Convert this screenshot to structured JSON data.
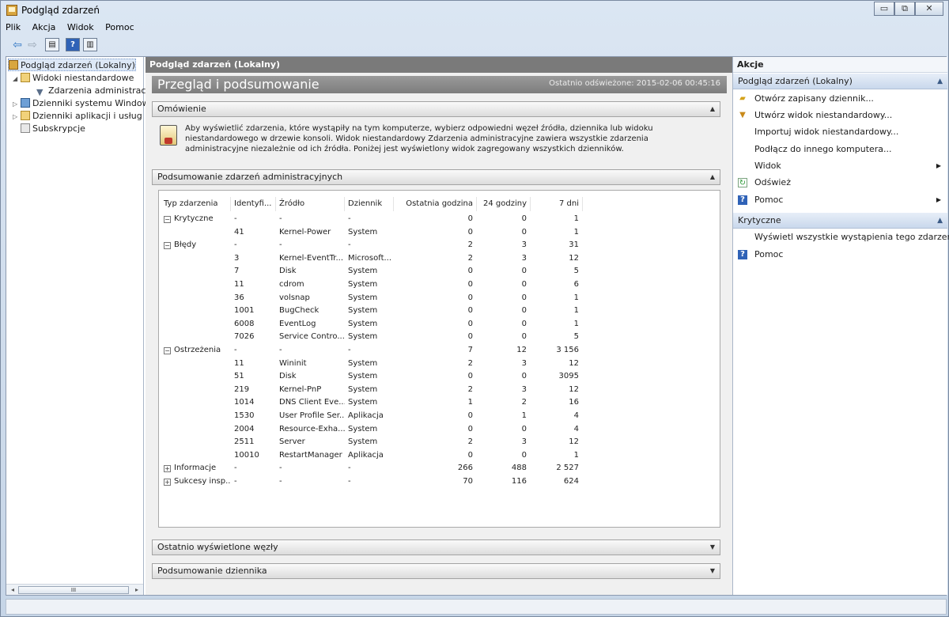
{
  "window": {
    "title": "Podgląd zdarzeń",
    "min_glyph": "▭",
    "max_glyph": "⧉",
    "close_glyph": "✕"
  },
  "menu": [
    "Plik",
    "Akcja",
    "Widok",
    "Pomoc"
  ],
  "toolbar": {
    "back_glyph": "⇦",
    "forward_glyph": "⇨",
    "help_glyph": "?"
  },
  "tree": {
    "root": "Podgląd zdarzeń (Lokalny)",
    "custom_views": "Widoki niestandardowe",
    "admin_events": "Zdarzenia administracyjne",
    "windows_logs": "Dzienniki systemu Windows",
    "app_logs": "Dzienniki aplikacji i usług",
    "subscriptions": "Subskrypcje",
    "scroll_glyph": "III"
  },
  "center": {
    "header": "Podgląd zdarzeń (Lokalny)",
    "banner_title": "Przegląd i podsumowanie",
    "refresh_text": "Ostatnio odświeżone: 2015-02-06 00:45:16",
    "overview_title": "Omówienie",
    "overview_text": "Aby wyświetlić zdarzenia, które wystąpiły na tym komputerze, wybierz odpowiedni węzeł źródła, dziennika lub widoku niestandardowego w drzewie konsoli. Widok niestandardowy Zdarzenia administracyjne zawiera wszystkie zdarzenia administracyjne niezależnie od ich źródła. Poniżej jest wyświetlony widok zagregowany wszystkich dzienników.",
    "summary_title": "Podsumowanie zdarzeń administracyjnych",
    "recent_nodes": "Ostatnio wyświetlone węzły",
    "log_summary": "Podsumowanie dziennika",
    "columns": [
      "Typ zdarzenia",
      "Identyfi...",
      "Źródło",
      "Dziennik",
      "Ostatnia godzina",
      "24 godziny",
      "7 dni"
    ],
    "rows": [
      {
        "type": "Krytyczne",
        "pm": "−",
        "id": "-",
        "source": "-",
        "log": "-",
        "h1": "0",
        "h24": "0",
        "d7": "1"
      },
      {
        "type": "",
        "pm": "",
        "id": "41",
        "source": "Kernel-Power",
        "log": "System",
        "h1": "0",
        "h24": "0",
        "d7": "1"
      },
      {
        "type": "Błędy",
        "pm": "−",
        "id": "-",
        "source": "-",
        "log": "-",
        "h1": "2",
        "h24": "3",
        "d7": "31"
      },
      {
        "type": "",
        "pm": "",
        "id": "3",
        "source": "Kernel-EventTr...",
        "log": "Microsoft...",
        "h1": "2",
        "h24": "3",
        "d7": "12"
      },
      {
        "type": "",
        "pm": "",
        "id": "7",
        "source": "Disk",
        "log": "System",
        "h1": "0",
        "h24": "0",
        "d7": "5"
      },
      {
        "type": "",
        "pm": "",
        "id": "11",
        "source": "cdrom",
        "log": "System",
        "h1": "0",
        "h24": "0",
        "d7": "6"
      },
      {
        "type": "",
        "pm": "",
        "id": "36",
        "source": "volsnap",
        "log": "System",
        "h1": "0",
        "h24": "0",
        "d7": "1"
      },
      {
        "type": "",
        "pm": "",
        "id": "1001",
        "source": "BugCheck",
        "log": "System",
        "h1": "0",
        "h24": "0",
        "d7": "1"
      },
      {
        "type": "",
        "pm": "",
        "id": "6008",
        "source": "EventLog",
        "log": "System",
        "h1": "0",
        "h24": "0",
        "d7": "1"
      },
      {
        "type": "",
        "pm": "",
        "id": "7026",
        "source": "Service Contro...",
        "log": "System",
        "h1": "0",
        "h24": "0",
        "d7": "5"
      },
      {
        "type": "Ostrzeżenia",
        "pm": "−",
        "id": "-",
        "source": "-",
        "log": "-",
        "h1": "7",
        "h24": "12",
        "d7": "3 156"
      },
      {
        "type": "",
        "pm": "",
        "id": "11",
        "source": "Wininit",
        "log": "System",
        "h1": "2",
        "h24": "3",
        "d7": "12"
      },
      {
        "type": "",
        "pm": "",
        "id": "51",
        "source": "Disk",
        "log": "System",
        "h1": "0",
        "h24": "0",
        "d7": "3095"
      },
      {
        "type": "",
        "pm": "",
        "id": "219",
        "source": "Kernel-PnP",
        "log": "System",
        "h1": "2",
        "h24": "3",
        "d7": "12"
      },
      {
        "type": "",
        "pm": "",
        "id": "1014",
        "source": "DNS Client Eve...",
        "log": "System",
        "h1": "1",
        "h24": "2",
        "d7": "16"
      },
      {
        "type": "",
        "pm": "",
        "id": "1530",
        "source": "User Profile Ser...",
        "log": "Aplikacja",
        "h1": "0",
        "h24": "1",
        "d7": "4"
      },
      {
        "type": "",
        "pm": "",
        "id": "2004",
        "source": "Resource-Exha...",
        "log": "System",
        "h1": "0",
        "h24": "0",
        "d7": "4"
      },
      {
        "type": "",
        "pm": "",
        "id": "2511",
        "source": "Server",
        "log": "System",
        "h1": "2",
        "h24": "3",
        "d7": "12"
      },
      {
        "type": "",
        "pm": "",
        "id": "10010",
        "source": "RestartManager",
        "log": "Aplikacja",
        "h1": "0",
        "h24": "0",
        "d7": "1"
      },
      {
        "type": "Informacje",
        "pm": "+",
        "id": "-",
        "source": "-",
        "log": "-",
        "h1": "266",
        "h24": "488",
        "d7": "2 527"
      },
      {
        "type": "Sukcesy insp...",
        "pm": "+",
        "id": "-",
        "source": "-",
        "log": "-",
        "h1": "70",
        "h24": "116",
        "d7": "624"
      }
    ]
  },
  "actions": {
    "header": "Akcje",
    "group1": "Podgląd zdarzeń (Lokalny)",
    "open_saved": "Otwórz zapisany dziennik...",
    "create_view": "Utwórz widok niestandardowy...",
    "import_view": "Importuj widok niestandardowy...",
    "connect": "Podłącz do innego komputera...",
    "view": "Widok",
    "refresh": "Odśwież",
    "help": "Pomoc",
    "group2": "Krytyczne",
    "show_all": "Wyświetl wszystkie wystąpienia tego zdarzenia",
    "help2": "Pomoc"
  }
}
